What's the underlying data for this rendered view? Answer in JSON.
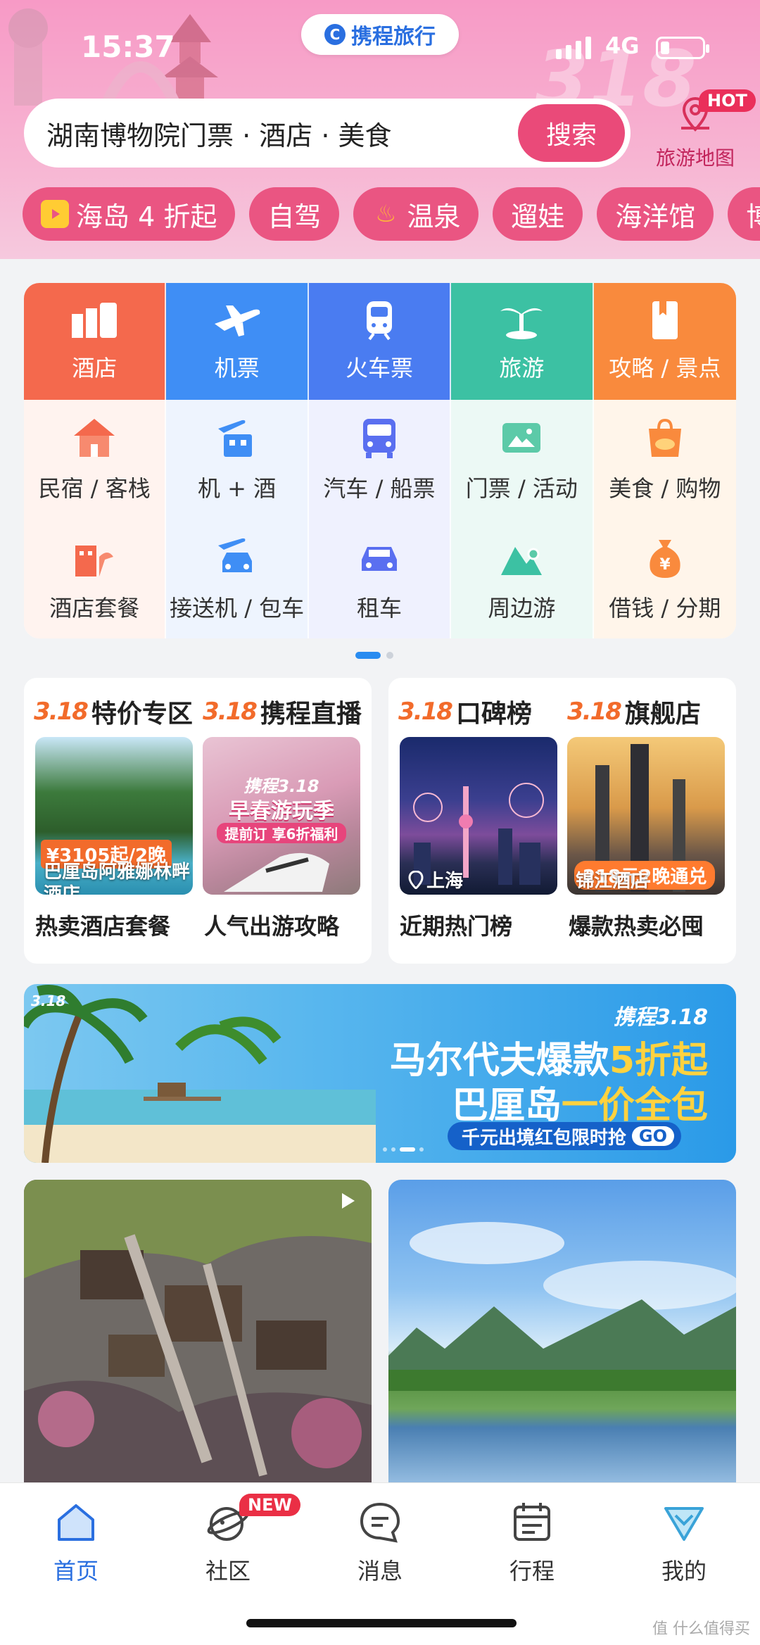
{
  "status": {
    "time": "15:37",
    "network": "4G"
  },
  "app": {
    "logo_text": "携程旅行"
  },
  "search": {
    "value": "湖南博物院门票 · 酒店 · 美食",
    "button": "搜索"
  },
  "map": {
    "label": "旅游地图",
    "badge": "HOT"
  },
  "chips": [
    {
      "label": "海岛 4 折起",
      "icon": "video-icon"
    },
    {
      "label": "自驾"
    },
    {
      "label": "温泉",
      "icon": "hot-spring-icon"
    },
    {
      "label": "遛娃"
    },
    {
      "label": "海洋馆"
    },
    {
      "label": "博"
    }
  ],
  "services": {
    "top": [
      {
        "label": "酒店",
        "color": "#f4694d",
        "icon": "hotel-icon"
      },
      {
        "label": "机票",
        "color": "#3f8ef5",
        "icon": "plane-icon"
      },
      {
        "label": "火车票",
        "color": "#4a7cf1",
        "icon": "train-icon"
      },
      {
        "label": "旅游",
        "color": "#3cc1a3",
        "icon": "palm-icon"
      },
      {
        "label": "攻略 / 景点",
        "color": "#f98a3d",
        "icon": "guide-icon"
      }
    ],
    "row2": [
      {
        "label": "民宿 / 客栈",
        "icon": "homestay-icon"
      },
      {
        "label": "机 + 酒",
        "icon": "flight-hotel-icon"
      },
      {
        "label": "汽车 / 船票",
        "icon": "bus-icon"
      },
      {
        "label": "门票 / 活动",
        "icon": "ticket-icon"
      },
      {
        "label": "美食 / 购物",
        "icon": "food-icon"
      }
    ],
    "row3": [
      {
        "label": "酒店套餐",
        "icon": "hotel-package-icon"
      },
      {
        "label": "接送机 / 包车",
        "icon": "transfer-icon"
      },
      {
        "label": "租车",
        "icon": "car-rental-icon"
      },
      {
        "label": "周边游",
        "icon": "nearby-icon"
      },
      {
        "label": "借钱 / 分期",
        "icon": "money-bag-icon"
      }
    ]
  },
  "promos": {
    "left": [
      {
        "tag": "3.18",
        "title": "特价专区",
        "price": "¥3105起/2晚",
        "img_text": "巴厘岛阿雅娜林畔酒店",
        "caption": "热卖酒店套餐"
      },
      {
        "tag": "3.18",
        "title": "携程直播",
        "img_line1": "携程3.18",
        "img_line2": "早春游玩季",
        "img_line3": "提前订 享6折福利",
        "caption": "人气出游攻略"
      }
    ],
    "right": [
      {
        "tag": "3.18",
        "title": "口碑榜",
        "img_text": "上海",
        "caption": "近期热门榜"
      },
      {
        "tag": "3.18",
        "title": "旗舰店",
        "overlay": "218元2晚通兑",
        "img_text": "锦江酒店",
        "caption": "爆款热卖必囤"
      }
    ]
  },
  "banner": {
    "badge": "3.18",
    "top": "携程3.18",
    "line1_a": "马尔代夫爆款",
    "line1_b": "5折起",
    "line2_a": "巴厘岛",
    "line2_b": "一价全包",
    "cta": "千元出境红包限时抢",
    "go": "GO"
  },
  "tabs": [
    {
      "label": "首页",
      "icon": "home-icon",
      "active": true
    },
    {
      "label": "社区",
      "icon": "community-icon",
      "badge": "NEW"
    },
    {
      "label": "消息",
      "icon": "message-icon"
    },
    {
      "label": "行程",
      "icon": "calendar-icon"
    },
    {
      "label": "我的",
      "icon": "profile-icon"
    }
  ],
  "colors": {
    "accent": "#ea4a79",
    "brand_blue": "#2a6fe0"
  },
  "watermark": "值 什么值得买"
}
